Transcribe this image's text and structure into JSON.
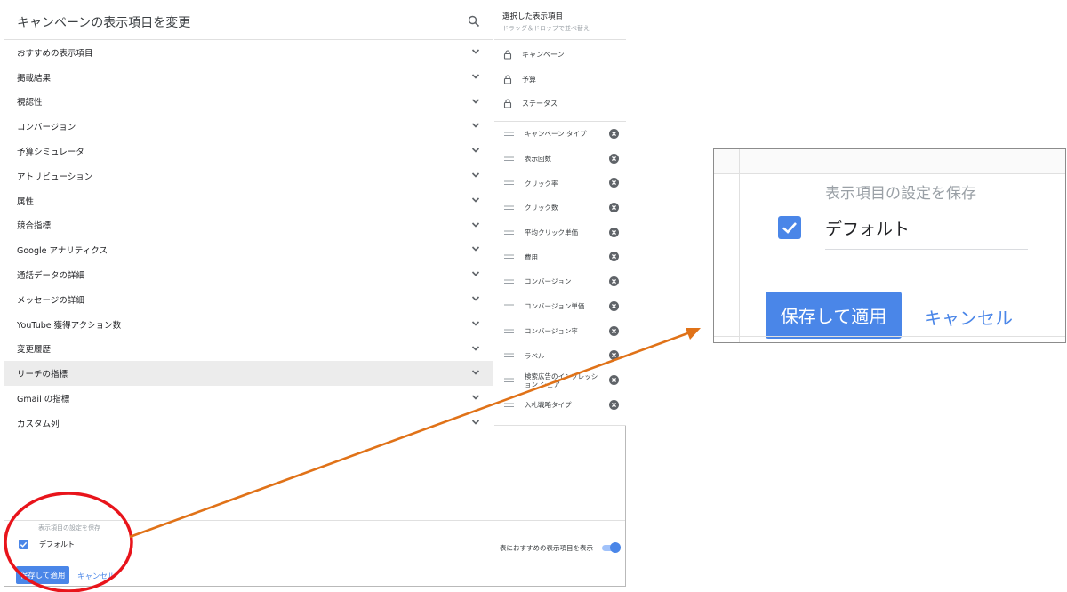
{
  "dialog": {
    "title": "キャンペーンの表示項目を変更",
    "search_icon": "search-icon",
    "categories": [
      {
        "label": "おすすめの表示項目",
        "active": false
      },
      {
        "label": "掲載結果",
        "active": false
      },
      {
        "label": "視認性",
        "active": false
      },
      {
        "label": "コンバージョン",
        "active": false
      },
      {
        "label": "予算シミュレータ",
        "active": false
      },
      {
        "label": "アトリビューション",
        "active": false
      },
      {
        "label": "属性",
        "active": false
      },
      {
        "label": "競合指標",
        "active": false
      },
      {
        "label": "Google アナリティクス",
        "active": false
      },
      {
        "label": "通話データの詳細",
        "active": false
      },
      {
        "label": "メッセージの詳細",
        "active": false
      },
      {
        "label": "YouTube 獲得アクション数",
        "active": false
      },
      {
        "label": "変更履歴",
        "active": false
      },
      {
        "label": "リーチの指標",
        "active": true
      },
      {
        "label": "Gmail の指標",
        "active": false
      },
      {
        "label": "カスタム列",
        "active": false
      }
    ]
  },
  "selected_panel": {
    "title": "選択した表示項目",
    "subtitle": "ドラッグ＆ドロップで並べ替え",
    "locked": [
      "キャンペーン",
      "予算",
      "ステータス"
    ],
    "items": [
      "キャンペーン タイプ",
      "表示回数",
      "クリック率",
      "クリック数",
      "平均クリック単価",
      "費用",
      "コンバージョン",
      "コンバージョン単価",
      "コンバージョン率",
      "ラベル",
      "検索広告のインプレッション シェア",
      "入札戦略タイプ"
    ]
  },
  "footer": {
    "save_title": "表示項目の設定を保存",
    "default_label": "デフォルト",
    "default_checked": true,
    "apply_label": "保存して適用",
    "cancel_label": "キャンセル",
    "toggle_label": "表におすすめの表示項目を表示",
    "toggle_on": true
  },
  "callout": {
    "save_title": "表示項目の設定を保存",
    "default_label": "デフォルト",
    "apply_label": "保存して適用",
    "cancel_label": "キャンセル"
  },
  "annotation": {
    "circle_color": "#e8141b",
    "arrow_color": "#e07218"
  },
  "colors": {
    "accent": "#4a86e8",
    "active_row": "#ececec"
  }
}
